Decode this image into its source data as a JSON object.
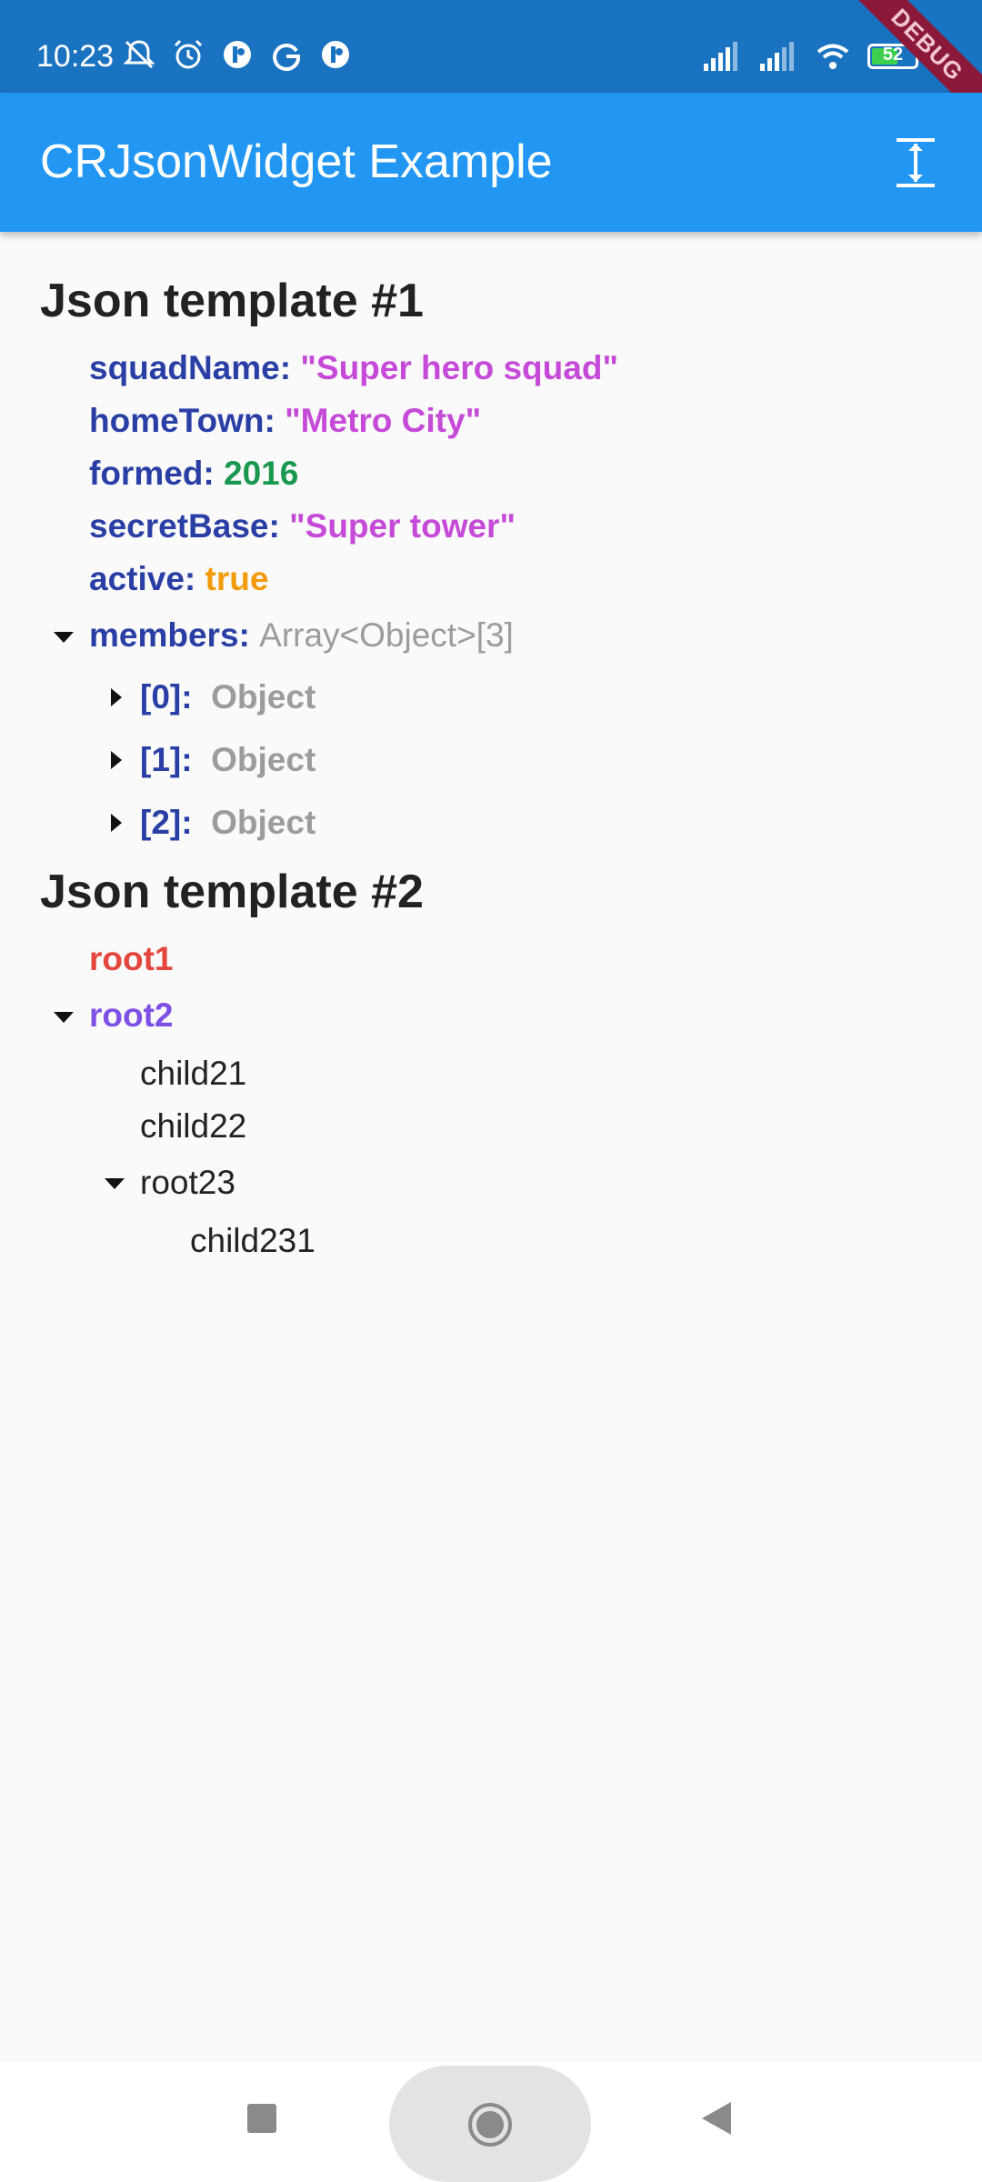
{
  "status_bar": {
    "time": "10:23",
    "battery": "52",
    "debug_label": "DEBUG",
    "icons": [
      "muted-bell-icon",
      "alarm-icon",
      "app-notification-icon",
      "google-icon",
      "app-notification-icon",
      "signal-icon",
      "signal-icon",
      "wifi-icon",
      "battery-icon"
    ]
  },
  "app_bar": {
    "title": "CRJsonWidget Example",
    "action_icon": "expand-collapse-icon"
  },
  "template1": {
    "title": "Json template #1",
    "fields": [
      {
        "key": "squadName",
        "value": "\"Super hero squad\""
      },
      {
        "key": "homeTown",
        "value": "\"Metro City\""
      },
      {
        "key": "formed",
        "value": "2016"
      },
      {
        "key": "secretBase",
        "value": "\"Super tower\""
      },
      {
        "key": "active",
        "value": "true"
      }
    ],
    "members": {
      "key": "members",
      "type": "Array<Object>[3]",
      "items": [
        {
          "key": "[0]",
          "type": "Object"
        },
        {
          "key": "[1]",
          "type": "Object"
        },
        {
          "key": "[2]",
          "type": "Object"
        }
      ]
    }
  },
  "template2": {
    "title": "Json template #2",
    "root1": "root1",
    "root2": "root2",
    "child21": "child21",
    "child22": "child22",
    "root23": "root23",
    "child231": "child231"
  },
  "colors": {
    "status_bar": "#1a73c1",
    "app_bar": "#2196f3",
    "key": "#2a3fa5",
    "string": "#c64ad8",
    "number": "#1a9850",
    "boolean": "#f29b0c",
    "meta": "#9c9c9c",
    "root1": "#e2463d",
    "root2": "#7e50e6"
  },
  "nav_bar": {
    "icons": [
      "recents-square-icon",
      "home-circle-icon",
      "back-triangle-icon"
    ]
  }
}
